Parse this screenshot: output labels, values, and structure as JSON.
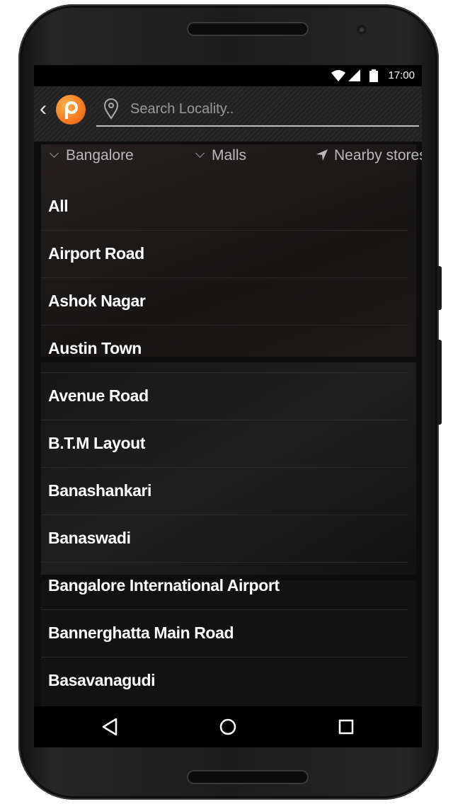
{
  "status_bar": {
    "time": "17:00"
  },
  "toolbar": {
    "search_placeholder": "Search Locality.."
  },
  "filters": {
    "city": "Bangalore",
    "category": "Malls",
    "nearby": "Nearby stores"
  },
  "localities": [
    "All",
    "Airport Road",
    "Ashok Nagar",
    "Austin Town",
    "Avenue Road",
    "B.T.M Layout",
    "Banashankari",
    "Banaswadi",
    "Bangalore International Airport",
    "Bannerghatta Main Road",
    "Basavanagudi"
  ],
  "colors": {
    "brand": "#f47a22",
    "list_text": "#ffffff",
    "muted_text": "#b9b9b9"
  },
  "icons": {
    "back": "chevron-left-icon",
    "logo": "app-logo-icon",
    "search": "location-pin-icon",
    "nearby": "navigation-arrow-icon",
    "nav_back": "triangle-back-icon",
    "nav_home": "circle-home-icon",
    "nav_recent": "square-recent-icon"
  }
}
